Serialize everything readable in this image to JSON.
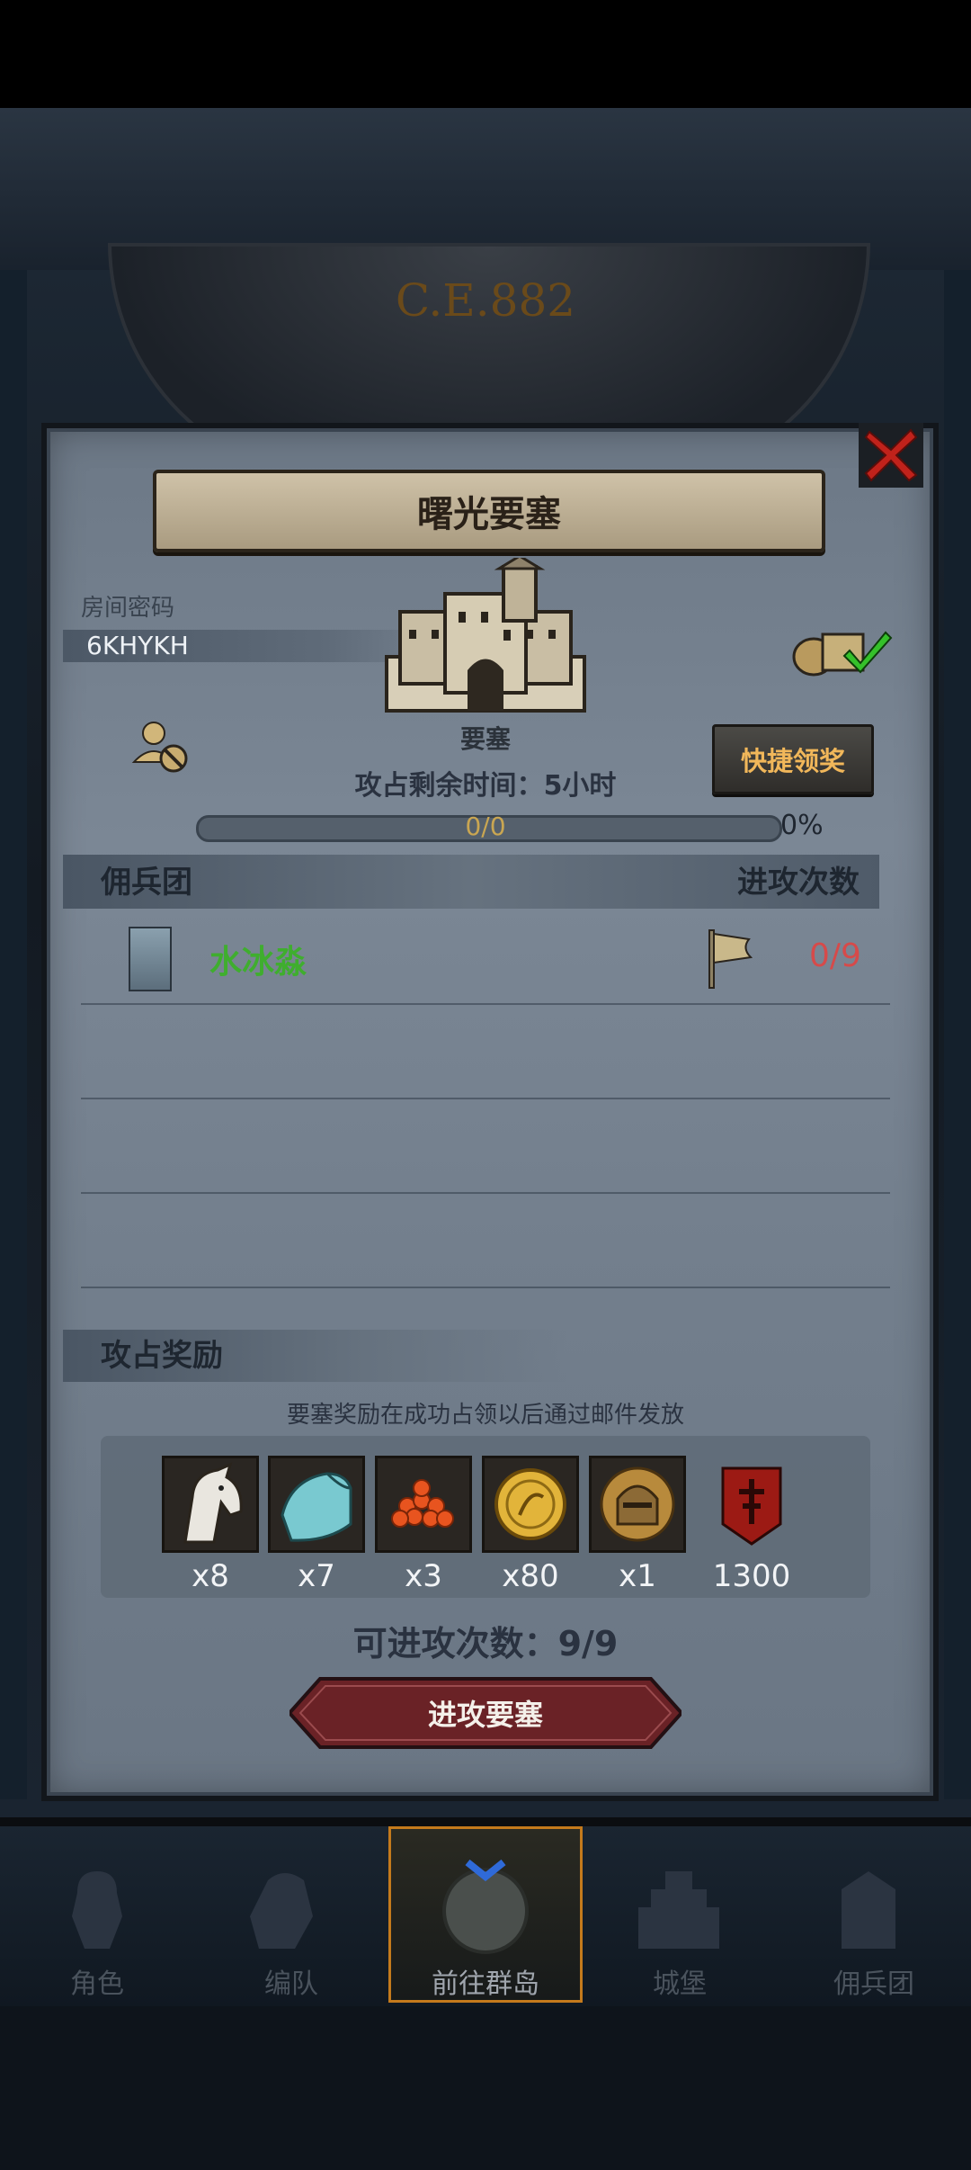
{
  "background": {
    "era": "C.E.882"
  },
  "popup": {
    "title": "曙光要塞",
    "room_label": "房间密码",
    "room_code": "6KHYKH",
    "building_label": "要塞",
    "quick_claim_label": "快捷领奖",
    "time_prefix": "攻占剩余时间：",
    "time_value": "5小时",
    "progress_text": "0/0",
    "progress_percent": "0%",
    "progress_fraction": 0,
    "table_header_left": "佣兵团",
    "table_header_right": "进攻次数",
    "rows": [
      {
        "name": "水冰淼",
        "count": "0/9"
      }
    ],
    "reward_title": "攻占奖励",
    "reward_note": "要塞奖励在成功占领以后通过邮件发放",
    "rewards": [
      {
        "icon": "horse-icon",
        "qty": "x8"
      },
      {
        "icon": "cloth-icon",
        "qty": "x7"
      },
      {
        "icon": "caviar-icon",
        "qty": "x3"
      },
      {
        "icon": "gold-coin-icon",
        "qty": "x80"
      },
      {
        "icon": "knight-helmet-icon",
        "qty": "x1"
      },
      {
        "icon": "red-banner-icon",
        "qty": "1300"
      }
    ],
    "attack_count_label": "可进攻次数：9/9",
    "attack_button_label": "进攻要塞"
  },
  "nav": {
    "items": [
      {
        "label": "角色"
      },
      {
        "label": "编队"
      },
      {
        "label": "前往群岛"
      },
      {
        "label": "城堡"
      },
      {
        "label": "佣兵团"
      }
    ],
    "active_index": 2
  },
  "colors": {
    "accent_orange": "#c47a1c",
    "merc_green": "#3fae2e",
    "count_red": "#d64a4a",
    "quick_text": "#f1b75a"
  }
}
